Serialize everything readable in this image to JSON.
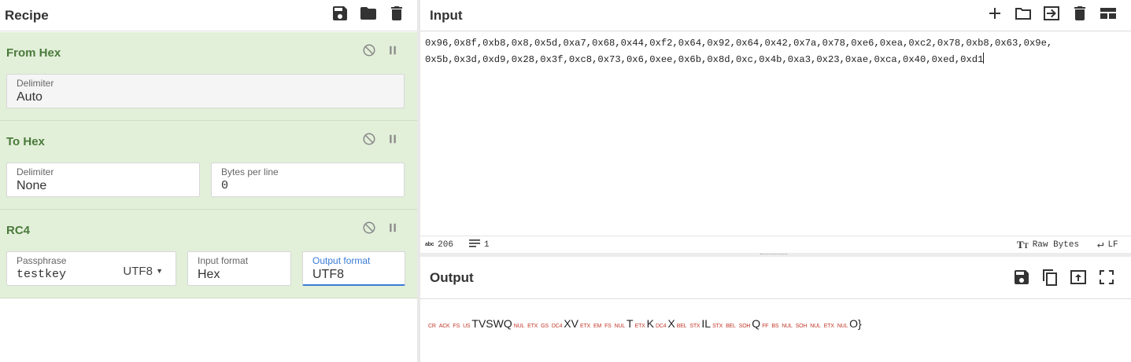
{
  "recipe": {
    "title": "Recipe",
    "icons": [
      "save-icon",
      "folder-icon",
      "trash-icon"
    ],
    "operations": [
      {
        "name": "From Hex",
        "fields": [
          {
            "label": "Delimiter",
            "value": "Auto"
          }
        ]
      },
      {
        "name": "To Hex",
        "fields": [
          {
            "label": "Delimiter",
            "value": "None"
          },
          {
            "label": "Bytes per line",
            "value": "0"
          }
        ]
      },
      {
        "name": "RC4",
        "fields": [
          {
            "label": "Passphrase",
            "value": "testkey",
            "encoding": "UTF8"
          },
          {
            "label": "Input format",
            "value": "Hex"
          },
          {
            "label": "Output format",
            "value": "UTF8"
          }
        ]
      }
    ]
  },
  "input": {
    "title": "Input",
    "icons": [
      "plus-icon",
      "folder-icon",
      "import-icon",
      "trash-icon",
      "layout-icon"
    ],
    "line1": "0x96,0x8f,0xb8,0x8,0x5d,0xa7,0x68,0x44,0xf2,0x64,0x92,0x64,0x42,0x7a,0x78,0xe6,0xea,0xc2,0x78,0xb8,0x63,0x9e,",
    "line2": "0x5b,0x3d,0xd9,0x28,0x3f,0xc8,0x73,0x6,0xee,0x6b,0x8d,0xc,0x4b,0xa3,0x23,0xae,0xca,0x40,0xed,0xd1",
    "status": {
      "abc_label": "abc",
      "length": "206",
      "lines": "1",
      "raw_bytes": "Raw Bytes",
      "eol": "LF"
    }
  },
  "output": {
    "title": "Output",
    "icons": [
      "save-icon",
      "copy-icon",
      "replace-input-icon",
      "maximize-icon"
    ],
    "tokens": [
      {
        "t": "ctl",
        "v": "CR"
      },
      {
        "t": "ctl",
        "v": "ACK"
      },
      {
        "t": "ctl",
        "v": "FS"
      },
      {
        "t": "ctl",
        "v": "US"
      },
      {
        "t": "chr",
        "v": "TVSWQ"
      },
      {
        "t": "ctl",
        "v": "NUL"
      },
      {
        "t": "ctl",
        "v": "ETX"
      },
      {
        "t": "ctl",
        "v": "GS"
      },
      {
        "t": "ctl",
        "v": "DC4"
      },
      {
        "t": "chr",
        "v": "XV"
      },
      {
        "t": "ctl",
        "v": "ETX"
      },
      {
        "t": "ctl",
        "v": "EM"
      },
      {
        "t": "ctl",
        "v": "FS"
      },
      {
        "t": "ctl",
        "v": "NUL"
      },
      {
        "t": "chr",
        "v": "T"
      },
      {
        "t": "ctl",
        "v": "ETX"
      },
      {
        "t": "chr",
        "v": "K"
      },
      {
        "t": "ctl",
        "v": "DC4"
      },
      {
        "t": "chr",
        "v": "X"
      },
      {
        "t": "ctl",
        "v": "BEL"
      },
      {
        "t": "ctl",
        "v": "STX"
      },
      {
        "t": "chr",
        "v": "IL"
      },
      {
        "t": "ctl",
        "v": "STX"
      },
      {
        "t": "ctl",
        "v": "BEL"
      },
      {
        "t": "ctl",
        "v": "SOH"
      },
      {
        "t": "chr",
        "v": "Q"
      },
      {
        "t": "ctl",
        "v": "FF"
      },
      {
        "t": "ctl",
        "v": "BS"
      },
      {
        "t": "ctl",
        "v": "NUL"
      },
      {
        "t": "ctl",
        "v": "SOH"
      },
      {
        "t": "ctl",
        "v": "NUL"
      },
      {
        "t": "ctl",
        "v": "ETX"
      },
      {
        "t": "ctl",
        "v": "NUL"
      },
      {
        "t": "chr",
        "v": "O}"
      }
    ]
  },
  "colors": {
    "op_background": "#e2efd9",
    "op_title": "#4a7a3b",
    "active_field": "#3a7bd5",
    "control_char": "#c0392b"
  }
}
